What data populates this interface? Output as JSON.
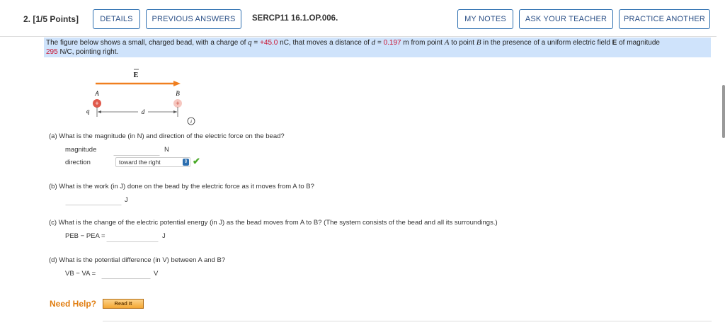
{
  "header": {
    "question_number": "2.  [1/5 Points]",
    "details": "DETAILS",
    "previous_answers": "PREVIOUS ANSWERS",
    "code": "SERCP11 16.1.OP.006.",
    "my_notes": "MY NOTES",
    "ask_teacher": "ASK YOUR TEACHER",
    "practice_another": "PRACTICE ANOTHER"
  },
  "prompt": {
    "t1": "The figure below shows a small, charged bead, with a charge of ",
    "q": "q",
    "t2": " = ",
    "q_value": "+45.0",
    "t3": " nC, that moves a distance of ",
    "d": "d",
    "t4": " = ",
    "d_value": "0.197",
    "t5": " m from point ",
    "A": "A",
    "t6": " to point ",
    "B": "B",
    "t7": " in the presence of a uniform electric field ",
    "E": "E",
    "t8": " of magnitude",
    "e_value": "295",
    "t9": " N/C, pointing right."
  },
  "figure": {
    "E_label": "E",
    "A_label": "A",
    "B_label": "B",
    "q_label": "q",
    "d_label": "d",
    "info": "i",
    "arrow_color": "#f07f1f"
  },
  "parts": {
    "a": {
      "question": "(a)   What is the magnitude (in N) and direction of the electric force on the bead?",
      "magnitude_label": "magnitude",
      "magnitude_value": "",
      "magnitude_unit": "N",
      "direction_label": "direction",
      "direction_value": "toward the right"
    },
    "b": {
      "question": "(b)   What is the work (in J) done on the bead by the electric force as it moves from A to B?",
      "value": "",
      "unit": "J"
    },
    "c": {
      "question": "(c)   What is the change of the electric potential energy (in J) as the bead moves from A to B? (The system consists of the bead and all its surroundings.)",
      "label": "PEB − PEA =",
      "value": "",
      "unit": "J"
    },
    "d": {
      "question": "(d)   What is the potential difference (in V) between A and B?",
      "label": "VB − VA =",
      "value": "",
      "unit": "V"
    }
  },
  "help": {
    "need_help": "Need Help?",
    "read_it": "Read It"
  }
}
